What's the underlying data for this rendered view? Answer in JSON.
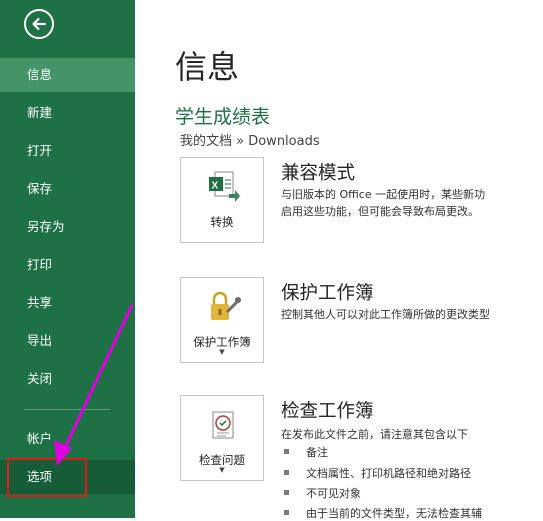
{
  "sidebar": {
    "items": [
      {
        "label": "信息"
      },
      {
        "label": "新建"
      },
      {
        "label": "打开"
      },
      {
        "label": "保存"
      },
      {
        "label": "另存为"
      },
      {
        "label": "打印"
      },
      {
        "label": "共享"
      },
      {
        "label": "导出"
      },
      {
        "label": "关闭"
      },
      {
        "label": "帐户"
      },
      {
        "label": "选项"
      }
    ]
  },
  "main": {
    "title": "信息",
    "doc_name": "学生成绩表",
    "breadcrumb": "我的文档 » Downloads",
    "sections": [
      {
        "button_label": "转换",
        "heading": "兼容模式",
        "lines": [
          "与旧版本的 Office 一起使用时，某些新功",
          "启用这些功能，但可能会导致布局更改。"
        ]
      },
      {
        "button_label": "保护工作簿",
        "heading": "保护工作簿",
        "lines": [
          "控制其他人可以对此工作簿所做的更改类型"
        ]
      },
      {
        "button_label": "检查问题",
        "heading": "检查工作簿",
        "lines": [
          "在发布此文件之前，请注意其包含以下"
        ],
        "bullets": [
          "备注",
          "文档属性、打印机路径和绝对路径",
          "不可见对象",
          "由于当前的文件类型，无法检查其辅"
        ]
      }
    ]
  },
  "colors": {
    "sidebar": "#1e7145",
    "active": "#439467",
    "accent": "#1e7145",
    "highlight": "#e01b1b",
    "arrow": "#e000e0"
  }
}
